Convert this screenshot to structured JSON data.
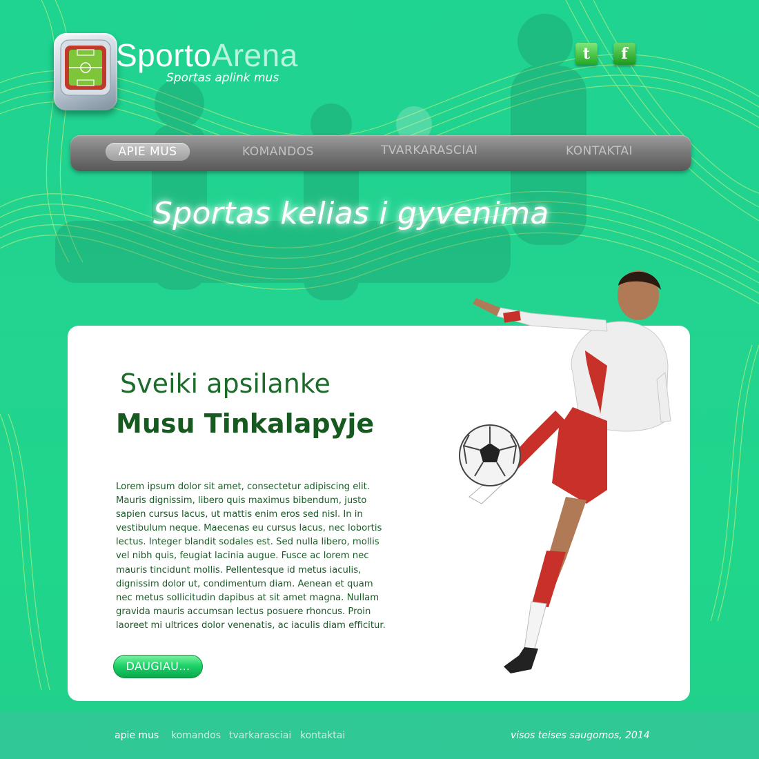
{
  "header": {
    "logo_part1": "Sporto",
    "logo_part2": "Arena",
    "tagline": "Sportas aplink mus",
    "icons": [
      "stadium-icon",
      "twitter-icon",
      "facebook-icon"
    ]
  },
  "nav": {
    "items": [
      {
        "label": "APIE MUS",
        "active": true
      },
      {
        "label": "KOMANDOS",
        "active": false
      },
      {
        "label": "TVARKARASCIAI",
        "active": false
      },
      {
        "label": "KONTAKTAI",
        "active": false
      }
    ]
  },
  "hero": {
    "slogan": "Sportas kelias i gyvenima"
  },
  "content": {
    "heading_line1": "Sveiki apsilanke",
    "heading_line2": "Musu Tinkalapyje",
    "body": "Lorem ipsum dolor sit amet, consectetur adipiscing elit. Mauris dignissim, libero quis maximus bibendum, justo sapien cursus lacus, ut mattis enim eros sed nisl. In in vestibulum neque. Maecenas eu cursus lacus, nec lobortis lectus. Integer blandit sodales est. Sed nulla libero, mollis vel nibh quis, feugiat lacinia augue. Fusce ac lorem nec mauris tincidunt mollis. Pellentesque id metus iaculis, dignissim dolor ut, condimentum diam. Aenean et quam nec metus sollicitudin dapibus at sit amet magna. Nullam gravida mauris accumsan lectus posuere rhoncus. Proin laoreet mi ultrices dolor venenatis, ac iaculis diam efficitur.",
    "more_label": "DAUGIAU..."
  },
  "footer": {
    "links": [
      "apie mus",
      "komandos",
      "tvarkarasciai",
      "kontaktai"
    ],
    "copyright": "visos teises saugomos, 2014"
  },
  "colors": {
    "background": "#22d38f",
    "heading": "#1d6b2a",
    "button": "#1fd36a",
    "nav": "#7a7a7a"
  }
}
